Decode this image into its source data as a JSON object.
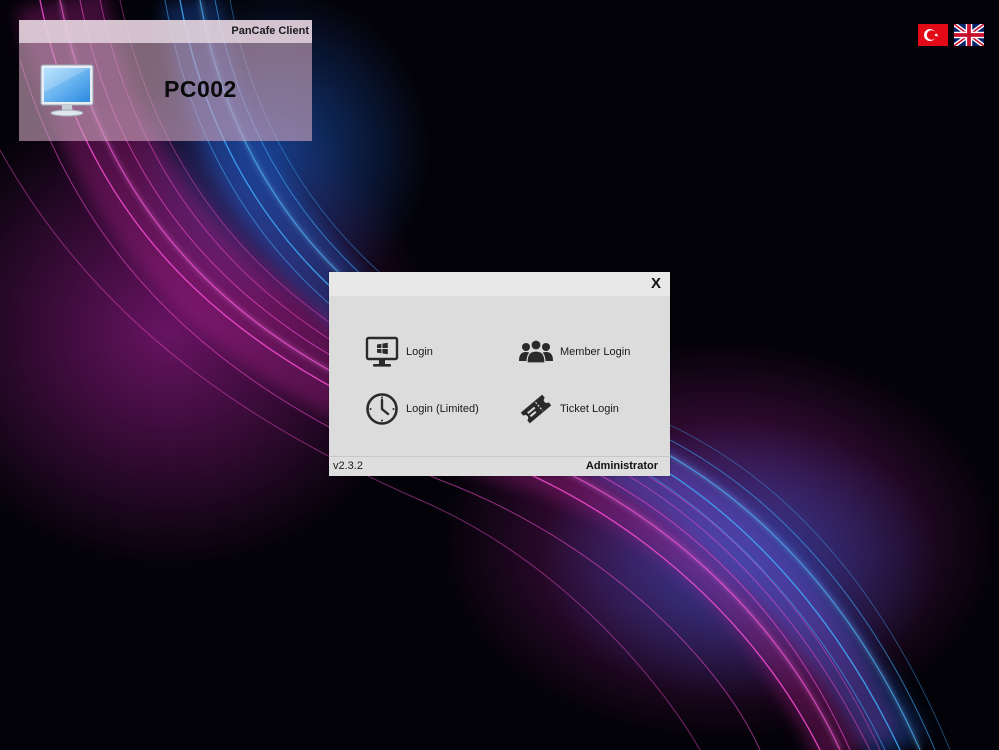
{
  "pc_panel": {
    "title": "PanCafe Client",
    "pc_name": "PC002",
    "icon": "monitor-icon"
  },
  "languages": [
    {
      "name": "tr",
      "icon": "turkey-flag-icon"
    },
    {
      "name": "en",
      "icon": "uk-flag-icon"
    }
  ],
  "dialog": {
    "close_label": "X",
    "options": {
      "login": {
        "label": "Login",
        "icon": "windows-monitor-icon"
      },
      "member_login": {
        "label": "Member Login",
        "icon": "users-group-icon"
      },
      "login_limited": {
        "label": "Login (Limited)",
        "icon": "clock-icon"
      },
      "ticket_login": {
        "label": "Ticket Login",
        "icon": "ticket-icon"
      }
    },
    "version": "v2.3.2",
    "admin_label": "Administrator"
  },
  "colors": {
    "dialog_bg": "#dcdcdc",
    "icon_color": "#2a2a2a",
    "wave_magenta": "#e040c0",
    "wave_blue": "#3aa0ff"
  }
}
